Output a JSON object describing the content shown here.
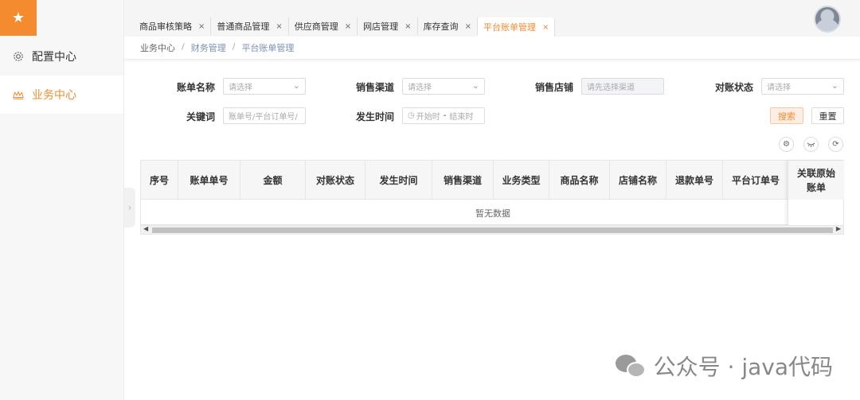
{
  "sidebar": {
    "logo_icon": "star-icon",
    "items": [
      {
        "label": "配置中心",
        "icon": "gear-icon"
      },
      {
        "label": "业务中心",
        "icon": "crown-icon"
      }
    ]
  },
  "tabs": [
    {
      "label": "商品审核策略",
      "close": "×"
    },
    {
      "label": "普通商品管理",
      "close": "×"
    },
    {
      "label": "供应商管理",
      "close": "×"
    },
    {
      "label": "网店管理",
      "close": "×"
    },
    {
      "label": "库存查询",
      "close": "×"
    },
    {
      "label": "平台账单管理",
      "close": "×"
    }
  ],
  "breadcrumb": [
    "业务中心",
    "财务管理",
    "平台账单管理"
  ],
  "breadcrumb_sep": "/",
  "filters": {
    "bill_name": {
      "label": "账单名称",
      "placeholder": "请选择"
    },
    "sales_channel": {
      "label": "销售渠道",
      "placeholder": "请选择"
    },
    "sales_store": {
      "label": "销售店铺",
      "placeholder": "请先选择渠道"
    },
    "reconcile_status": {
      "label": "对账状态",
      "placeholder": "请选择"
    },
    "keyword": {
      "label": "关键词",
      "placeholder": "账单号/平台订单号/"
    },
    "occur_time": {
      "label": "发生时间",
      "start": "开始时",
      "dash": "-",
      "end": "结束时"
    }
  },
  "buttons": {
    "search": "搜索",
    "reset": "重置"
  },
  "table": {
    "columns": [
      "序号",
      "账单单号",
      "金额",
      "对账状态",
      "发生时间",
      "销售渠道",
      "业务类型",
      "商品名称",
      "店铺名称",
      "退款单号",
      "平台订单号"
    ],
    "fixed_column": [
      "关联原始",
      "账单"
    ],
    "empty_text": "暂无数据"
  },
  "watermark": "公众号 · java代码",
  "colors": {
    "accent": "#f48b2f"
  }
}
